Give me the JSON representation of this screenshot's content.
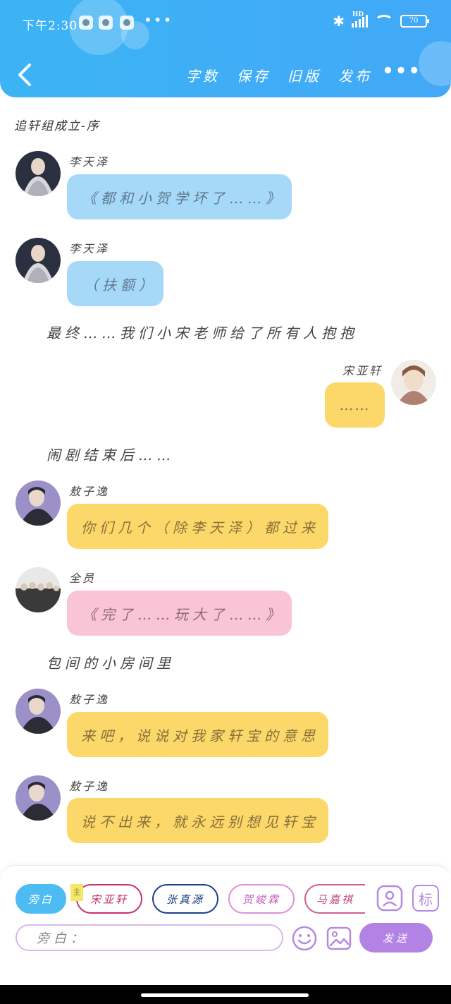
{
  "status_bar": {
    "time": "下午2:30",
    "more": "•••",
    "network": "HD",
    "battery": "70"
  },
  "header": {
    "back_icon": "chevron-left-icon",
    "actions": [
      "字数",
      "保存",
      "旧版",
      "发布"
    ],
    "more_icon": "•••"
  },
  "chat": {
    "title": "追轩组成立-序",
    "messages": [
      {
        "sender": "李天泽",
        "text": "《都和小贺学坏了……》",
        "color": "blue",
        "side": "left"
      },
      {
        "sender": "李天泽",
        "text": "（扶额）",
        "color": "blue",
        "side": "left"
      },
      {
        "narration": "最终……我们小宋老师给了所有人抱抱"
      },
      {
        "sender": "宋亚轩",
        "text": "……",
        "color": "yellow",
        "side": "right"
      },
      {
        "narration": "闹剧结束后……"
      },
      {
        "sender": "敖子逸",
        "text": "你们几个（除李天泽）都过来",
        "color": "yellow",
        "side": "left"
      },
      {
        "sender": "全员",
        "text": "《完了……玩大了……》",
        "color": "pink",
        "side": "left"
      },
      {
        "narration": "包间的小房间里"
      },
      {
        "sender": "敖子逸",
        "text": "来吧，说说对我家轩宝的意思",
        "color": "yellow",
        "side": "left"
      },
      {
        "sender": "敖子逸",
        "text": "说不出来，就永远别想见轩宝",
        "color": "yellow",
        "side": "left"
      }
    ]
  },
  "composer": {
    "roles": [
      {
        "label": "旁白",
        "active": true
      },
      {
        "label": "宋亚轩",
        "tag": "主"
      },
      {
        "label": "张真源"
      },
      {
        "label": "贺峻霖"
      },
      {
        "label": "马嘉祺"
      }
    ],
    "role_icon": "person-card-icon",
    "tag_label": "标",
    "input_prefix": "旁白：",
    "emoji_icon": "smile-icon",
    "image_icon": "image-icon",
    "send_label": "发送"
  },
  "colors": {
    "header": "#3cb4f4",
    "blue_bubble": "#a6d8f8",
    "yellow_bubble": "#fcd86a",
    "pink_bubble": "#f8c4d6",
    "send": "#b283e4"
  }
}
